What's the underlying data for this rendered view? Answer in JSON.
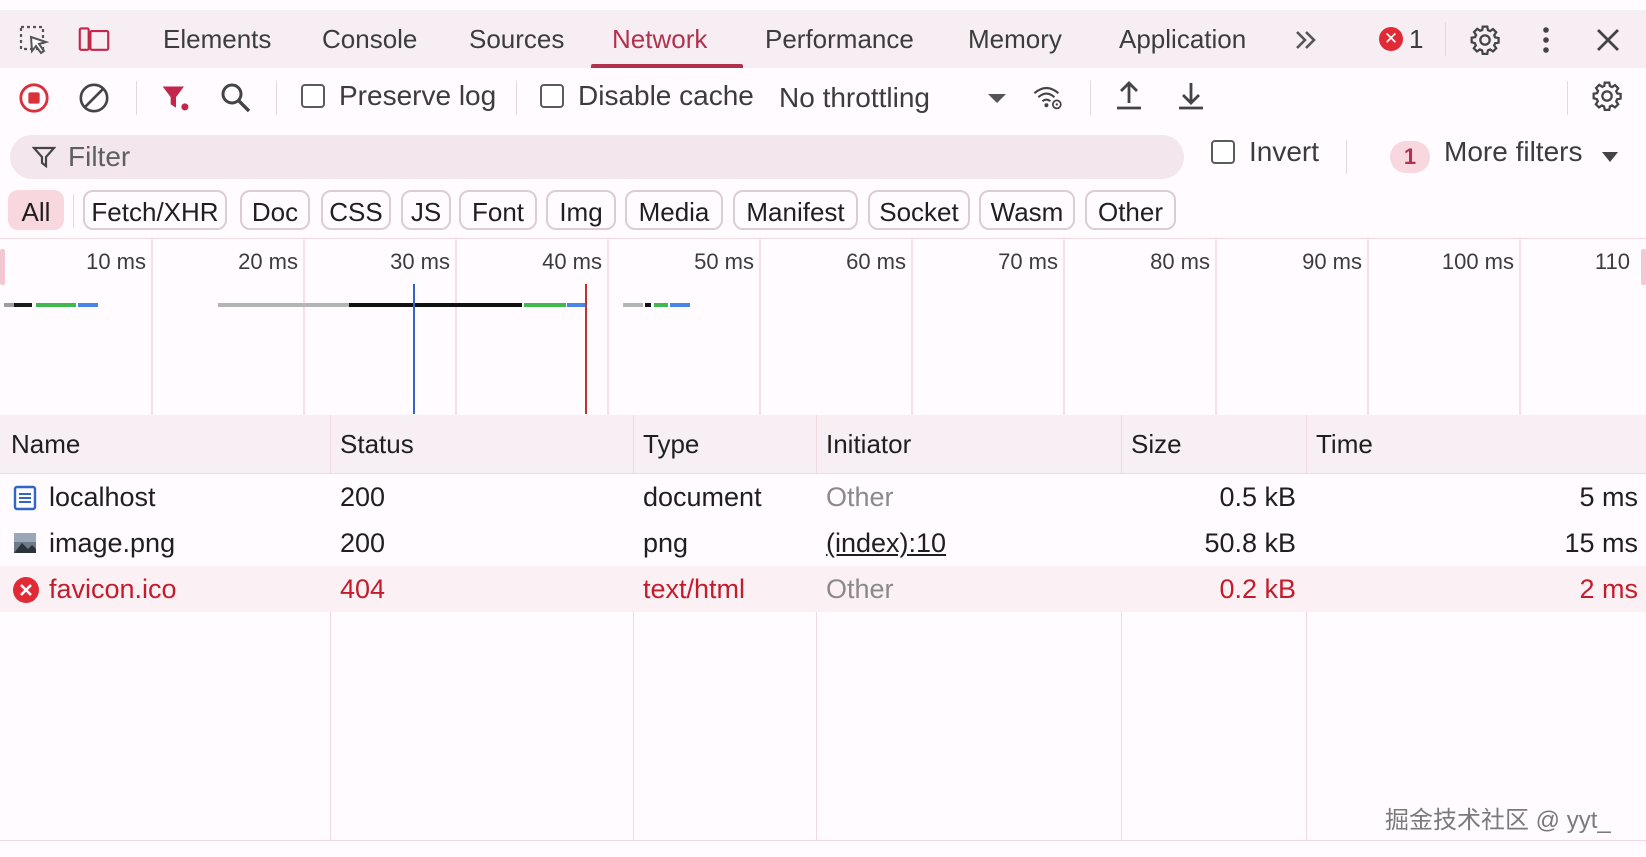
{
  "tabs": [
    {
      "label": "Elements"
    },
    {
      "label": "Console"
    },
    {
      "label": "Sources"
    },
    {
      "label": "Network"
    },
    {
      "label": "Performance"
    },
    {
      "label": "Memory"
    },
    {
      "label": "Application"
    }
  ],
  "active_tab": "Network",
  "error_count": "1",
  "toolbar": {
    "preserve_log": "Preserve log",
    "disable_cache": "Disable cache",
    "throttling": "No throttling"
  },
  "filter": {
    "placeholder": "Filter",
    "invert": "Invert",
    "more_filters_count": "1",
    "more_filters": "More filters"
  },
  "type_chips": [
    "All",
    "Fetch/XHR",
    "Doc",
    "CSS",
    "JS",
    "Font",
    "Img",
    "Media",
    "Manifest",
    "Socket",
    "Wasm",
    "Other"
  ],
  "timeline": {
    "ticks": [
      "10 ms",
      "20 ms",
      "30 ms",
      "40 ms",
      "50 ms",
      "60 ms",
      "70 ms",
      "80 ms",
      "90 ms",
      "100 ms",
      "110"
    ]
  },
  "table": {
    "columns": [
      "Name",
      "Status",
      "Type",
      "Initiator",
      "Size",
      "Time"
    ],
    "rows": [
      {
        "name": "localhost",
        "status": "200",
        "type": "document",
        "initiator": "Other",
        "size": "0.5 kB",
        "time": "5 ms",
        "icon": "document-icon",
        "error": false
      },
      {
        "name": "image.png",
        "status": "200",
        "type": "png",
        "initiator": "(index):10",
        "size": "50.8 kB",
        "time": "15 ms",
        "icon": "image-icon",
        "error": false
      },
      {
        "name": "favicon.ico",
        "status": "404",
        "type": "text/html",
        "initiator": "Other",
        "size": "0.2 kB",
        "time": "2 ms",
        "icon": "error-icon",
        "error": true
      }
    ]
  },
  "watermark": "掘金技术社区 @ yyt_",
  "colors": {
    "accent": "#b0324c",
    "error": "#c21d2c",
    "record": "#d9303b",
    "filter_funnel": "#c2264a",
    "dom_content_loaded": "#2f66c8",
    "load": "#c0322d"
  }
}
